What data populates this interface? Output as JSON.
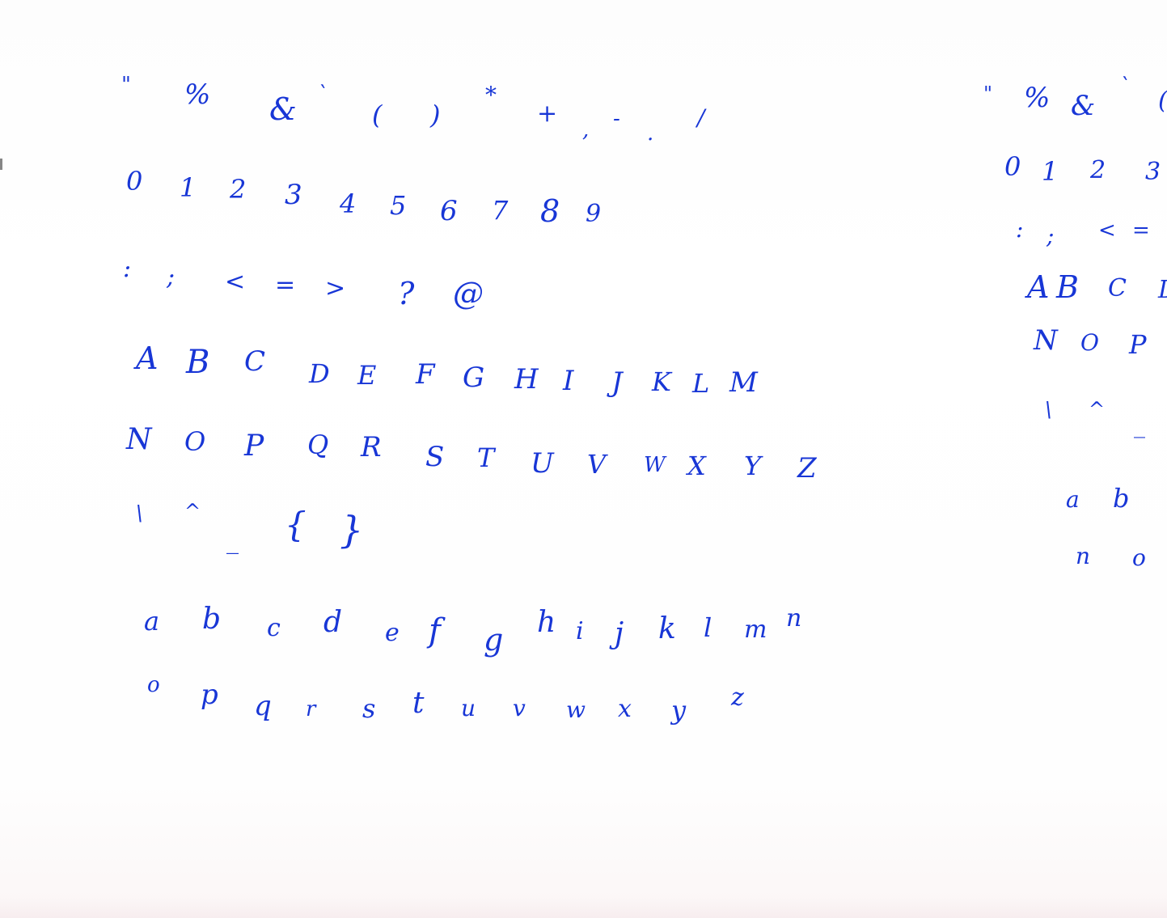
{
  "sheet": {
    "ink_color": "#1836d6",
    "paper_color": "#ffffff",
    "left_block": {
      "rows": [
        [
          "\"",
          "%",
          "&",
          "`",
          "(",
          ")",
          "*",
          "+",
          ",",
          "-",
          ".",
          "/"
        ],
        [
          "0",
          "1",
          "2",
          "3",
          "4",
          "5",
          "6",
          "7",
          "8",
          "9"
        ],
        [
          ":",
          ";",
          "<",
          "=",
          ">",
          "?",
          "@"
        ],
        [
          "A",
          "B",
          "C",
          "D",
          "E",
          "F",
          "G",
          "H",
          "I",
          "J",
          "K",
          "L",
          "M"
        ],
        [
          "N",
          "O",
          "P",
          "Q",
          "R",
          "S",
          "T",
          "U",
          "V",
          "W",
          "X",
          "Y",
          "Z"
        ],
        [
          "\\",
          "^",
          "_",
          "{",
          "}"
        ],
        [
          "a",
          "b",
          "c",
          "d",
          "e",
          "f",
          "g",
          "h",
          "i",
          "j",
          "k",
          "l",
          "m",
          "n"
        ],
        [
          "o",
          "p",
          "q",
          "r",
          "s",
          "t",
          "u",
          "v",
          "w",
          "x",
          "y",
          "z"
        ]
      ]
    },
    "right_block": {
      "rows": [
        [
          "\"",
          "%",
          "&",
          "`",
          "("
        ],
        [
          "0",
          "1",
          "2",
          "3"
        ],
        [
          ":",
          ";",
          "<",
          "="
        ],
        [
          "A",
          "B",
          "C",
          "D"
        ],
        [
          "N",
          "O",
          "P"
        ],
        [
          "\\",
          "^",
          "_"
        ],
        [
          "a",
          "b"
        ],
        [
          "n",
          "o"
        ]
      ]
    }
  }
}
